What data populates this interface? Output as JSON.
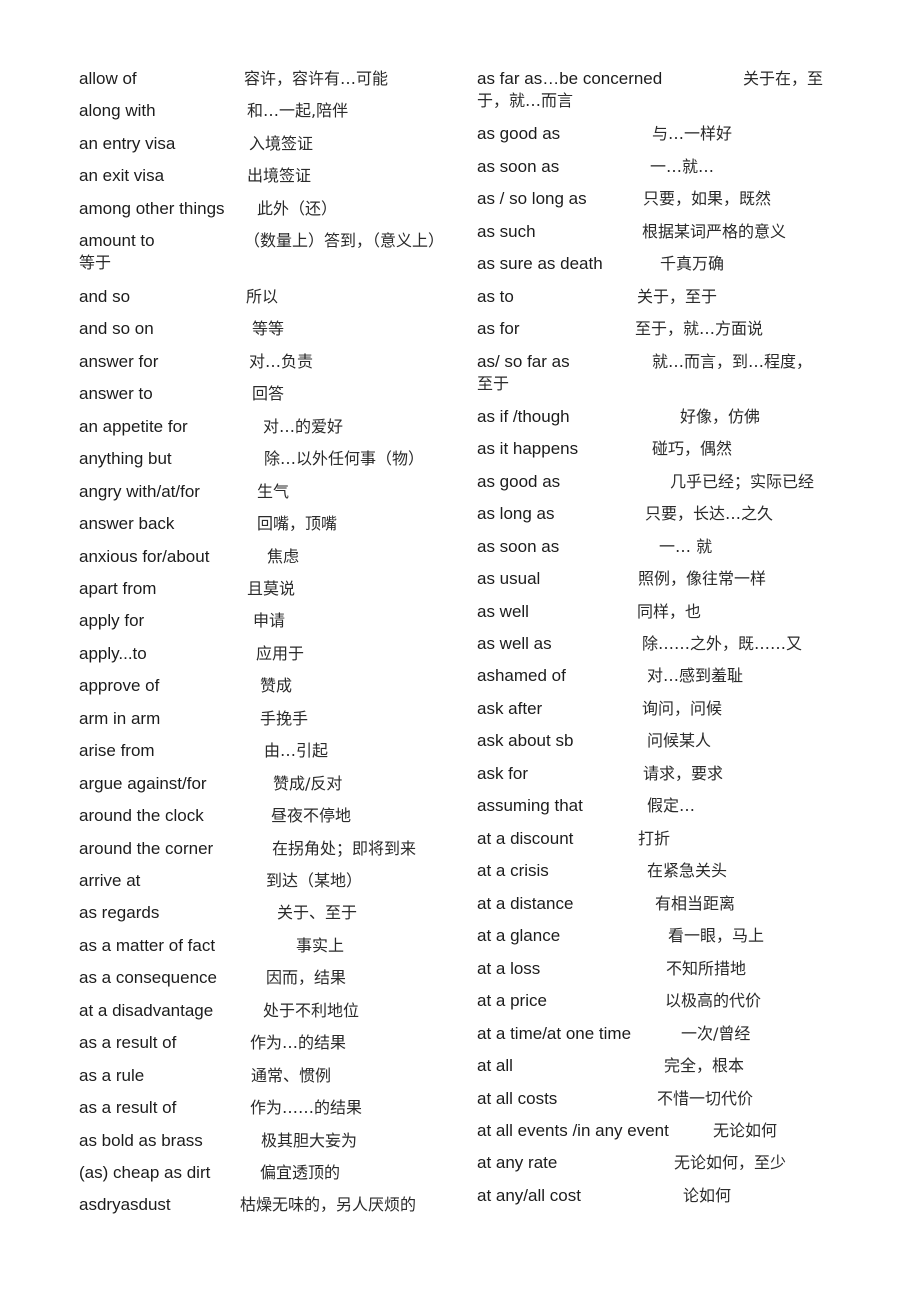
{
  "document": {
    "left_column": [
      {
        "en": "allow of",
        "zh": "容许，容许有…可能"
      },
      {
        "en": "along with",
        "zh": "和…一起,陪伴"
      },
      {
        "en": "an entry visa",
        "zh": "入境签证"
      },
      {
        "en": "an exit visa",
        "zh": "出境签证"
      },
      {
        "en": "among other things",
        "zh": "此外（还）"
      },
      {
        "en": "amount to",
        "zh": "（数量上）答到，（意义上）",
        "zh_cont": "等于"
      },
      {
        "en": "and so",
        "zh": "所以"
      },
      {
        "en": "and so on",
        "zh": "等等"
      },
      {
        "en": "answer for",
        "zh": "对…负责"
      },
      {
        "en": "answer to",
        "zh": "回答"
      },
      {
        "en": "an appetite for",
        "zh": "对…的爱好"
      },
      {
        "en": "anything but",
        "zh": "除…以外任何事（物）"
      },
      {
        "en": "angry with/at/for",
        "zh": "生气"
      },
      {
        "en": "answer back",
        "zh": "回嘴，顶嘴"
      },
      {
        "en": "anxious for/about",
        "zh": "焦虑"
      },
      {
        "en": "apart from",
        "zh": "且莫说"
      },
      {
        "en": "apply for",
        "zh": "申请"
      },
      {
        "en": "apply...to",
        "zh": "应用于"
      },
      {
        "en": "approve of",
        "zh": "赞成"
      },
      {
        "en": "arm in arm",
        "zh": "手挽手"
      },
      {
        "en": "arise from",
        "zh": "由…引起"
      },
      {
        "en": "argue against/for",
        "zh": "赞成/反对"
      },
      {
        "en": "around the clock",
        "zh": "昼夜不停地"
      },
      {
        "en": "around the corner",
        "zh": "在拐角处；即将到来"
      },
      {
        "en": "arrive at",
        "zh": "到达（某地）"
      },
      {
        "en": "as regards",
        "zh": "关于、至于"
      },
      {
        "en": "as a matter of   fact",
        "zh": "事实上"
      },
      {
        "en": "as a consequence",
        "zh": "因而，结果"
      },
      {
        "en": "at a disadvantage",
        "zh": "处于不利地位"
      },
      {
        "en": "as a result of",
        "zh": "作为…的结果"
      },
      {
        "en": "as a rule",
        "zh": "通常、惯例"
      },
      {
        "en": "as a result of",
        "zh": "作为……的结果"
      },
      {
        "en": "as bold as brass",
        "zh": "极其胆大妄为"
      },
      {
        "en": "(as) cheap as dirt",
        "zh": "偏宜透顶的"
      },
      {
        "en": "asdryasdust",
        "zh": "枯燥无味的，另人厌烦的"
      }
    ],
    "right_column": [
      {
        "en": "as far as…be concerned",
        "zh": "关于在，至",
        "zh_cont": "于，就…而言"
      },
      {
        "en": "as good as",
        "zh": "与…一样好"
      },
      {
        "en": "as soon as",
        "zh": "一…就…"
      },
      {
        "en": "as / so long as",
        "zh": "只要，如果，既然"
      },
      {
        "en": "as such",
        "zh": "根据某词严格的意义"
      },
      {
        "en": "as sure as death",
        "zh": "千真万确"
      },
      {
        "en": "as to",
        "zh": "关于，至于"
      },
      {
        "en": "as for",
        "zh": "至于，就…方面说"
      },
      {
        "en": "as/ so far as",
        "zh": "就…而言，到…程度，",
        "zh_cont": "至于"
      },
      {
        "en": "as if /though",
        "zh": "好像，仿佛"
      },
      {
        "en": "as it happens",
        "zh": "碰巧，偶然"
      },
      {
        "en": "as good as",
        "zh": "几乎已经；实际已经"
      },
      {
        "en": "as long as",
        "zh": "只要，长达…之久"
      },
      {
        "en": "as soon as",
        "zh": "一… 就"
      },
      {
        "en": "as usual",
        "zh": "照例，像往常一样"
      },
      {
        "en": "as well",
        "zh": "同样，也"
      },
      {
        "en": "as well as",
        "zh": "除……之外，既……又"
      },
      {
        "en": "ashamed of",
        "zh": "对…感到羞耻"
      },
      {
        "en": "ask after",
        "zh": "询问，问候"
      },
      {
        "en": "ask about sb",
        "zh": "问候某人"
      },
      {
        "en": "ask for",
        "zh": "请求，要求"
      },
      {
        "en": "assuming that",
        "zh": "假定…"
      },
      {
        "en": "at a discount",
        "zh": "打折"
      },
      {
        "en": "at a crisis",
        "zh": "在紧急关头"
      },
      {
        "en": "at a distance",
        "zh": "有相当距离"
      },
      {
        "en": "at a glance",
        "zh": "看一眼，马上"
      },
      {
        "en": "at a loss",
        "zh": "不知所措地"
      },
      {
        "en": "at a price",
        "zh": "以极高的代价"
      },
      {
        "en": "at a time/at one time",
        "zh": "一次/曾经"
      },
      {
        "en": "at all",
        "zh": "完全，根本"
      },
      {
        "en": "at all costs",
        "zh": "不惜一切代价"
      },
      {
        "en": "at all events /in any event",
        "zh": "无论如何"
      },
      {
        "en": "at any rate",
        "zh": "无论如何，至少"
      },
      {
        "en": "at any/all cost",
        "zh": "论如何"
      }
    ]
  }
}
